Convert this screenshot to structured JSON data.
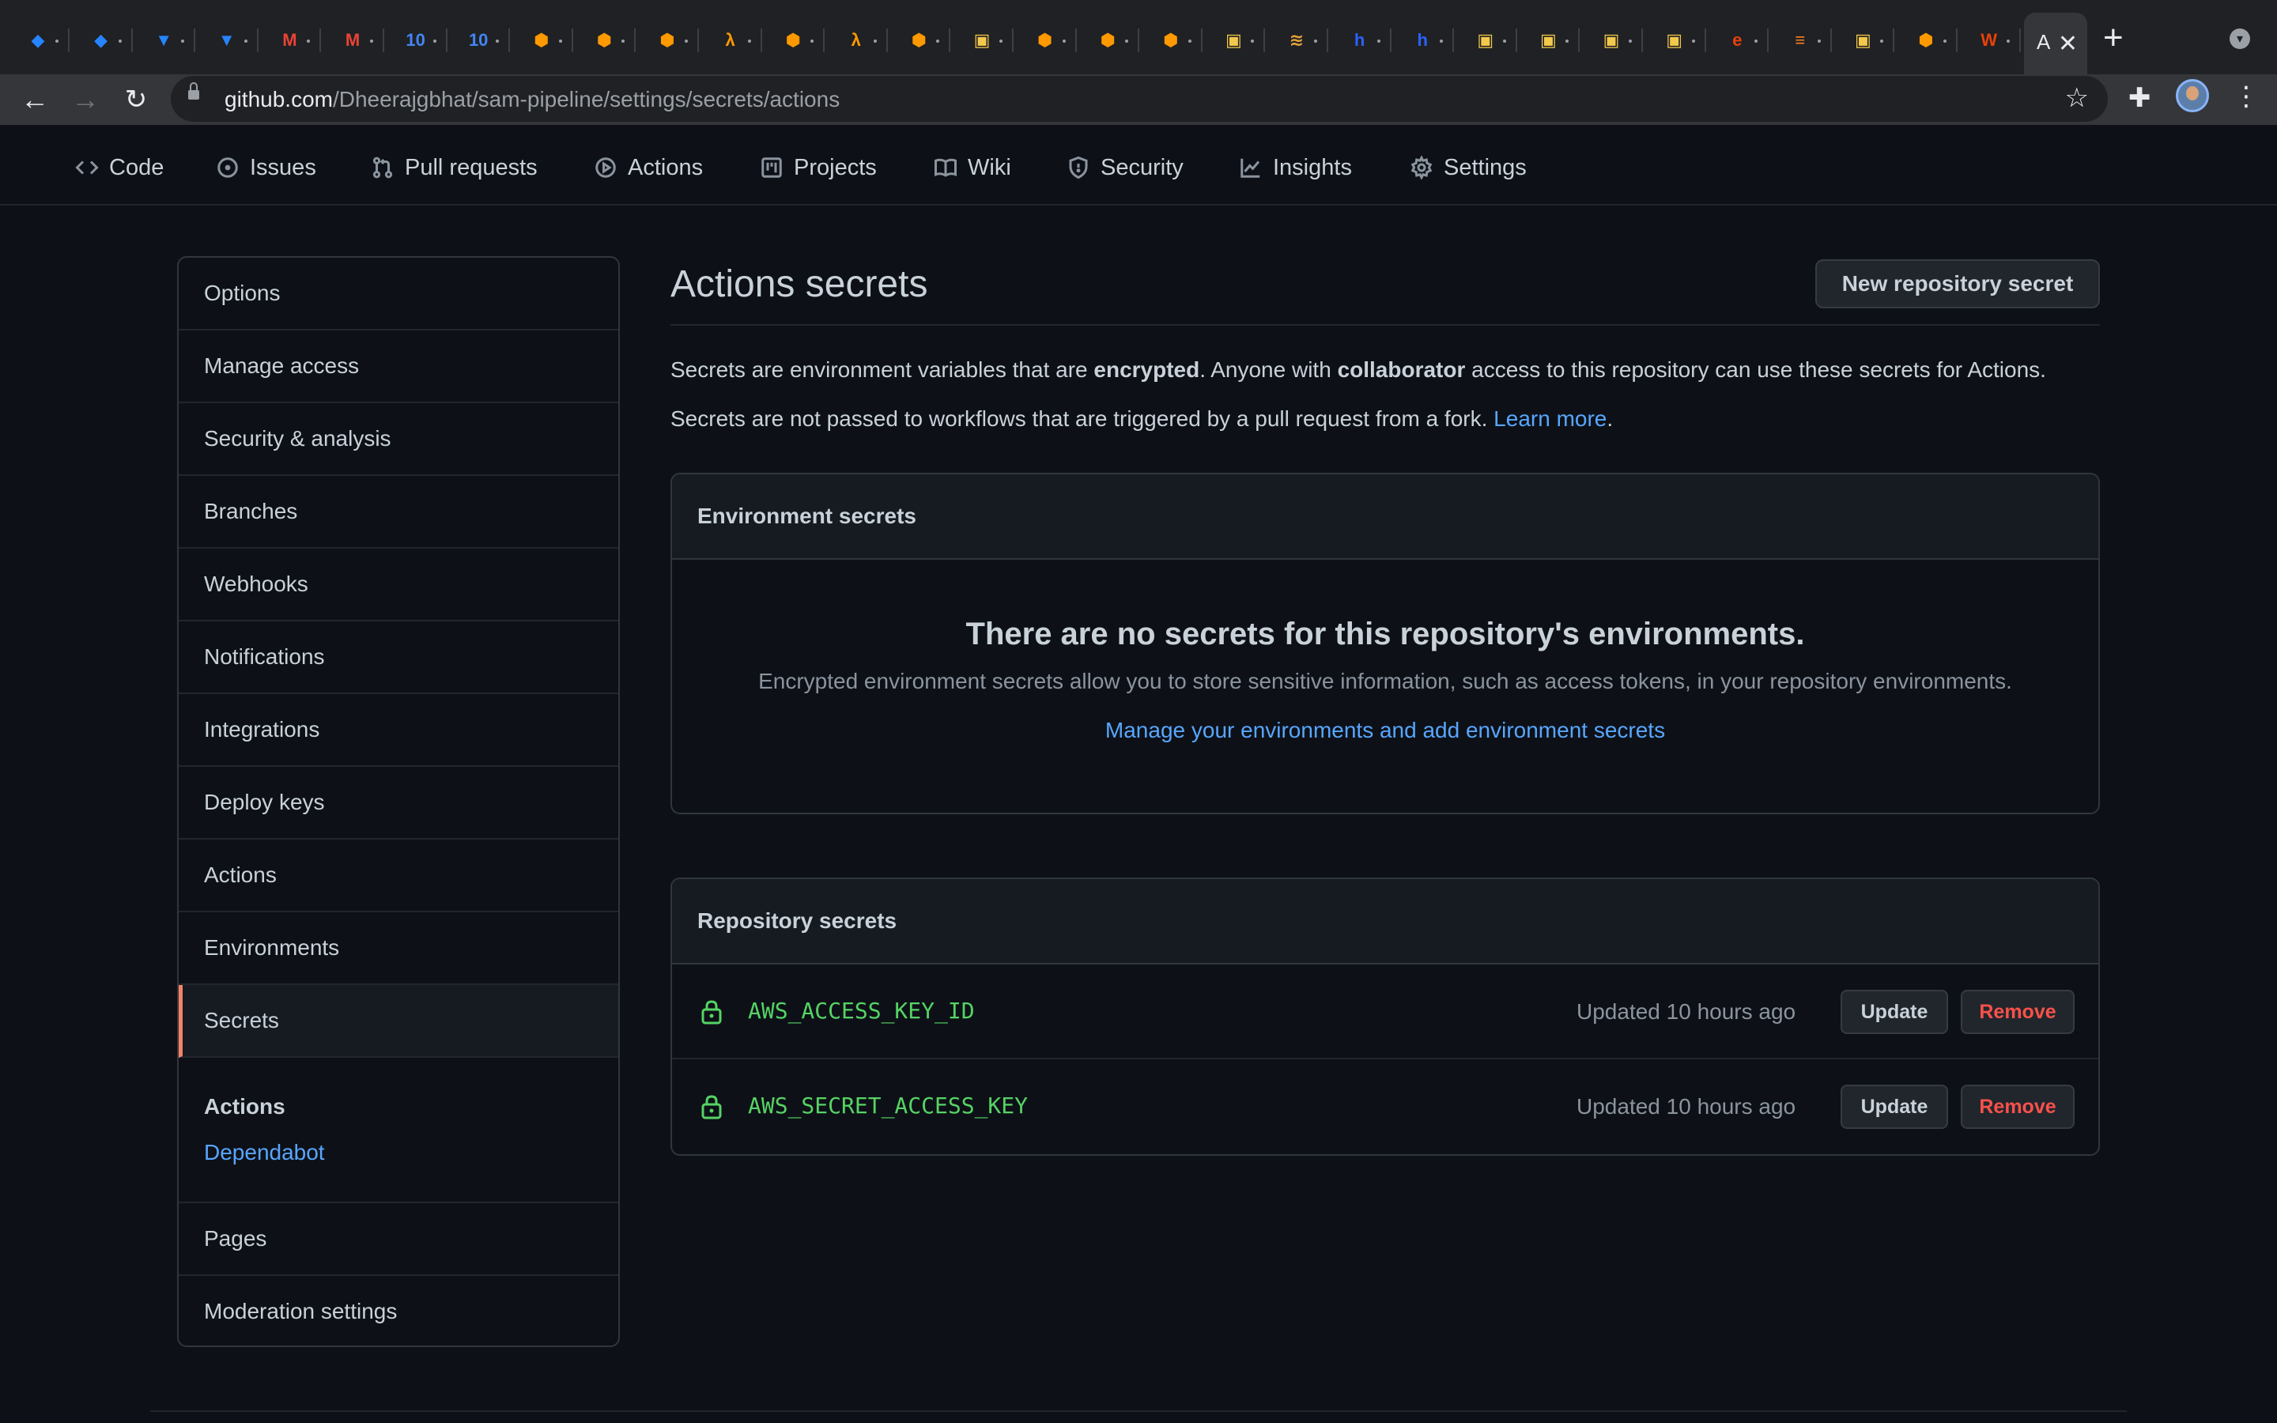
{
  "browser": {
    "tabs": [
      {
        "icon": "jira-icon",
        "color": "#2684ff",
        "glyph": "◆"
      },
      {
        "icon": "jira-icon",
        "color": "#2684ff",
        "glyph": "◆"
      },
      {
        "icon": "bitbucket-icon",
        "color": "#2684ff",
        "glyph": "▼"
      },
      {
        "icon": "bitbucket-icon",
        "color": "#2684ff",
        "glyph": "▼"
      },
      {
        "icon": "gmail-icon",
        "color": "#ea4335",
        "glyph": "M"
      },
      {
        "icon": "gmail-icon",
        "color": "#ea4335",
        "glyph": "M"
      },
      {
        "icon": "calendar-icon",
        "color": "#4285f4",
        "glyph": "10"
      },
      {
        "icon": "calendar-icon",
        "color": "#4285f4",
        "glyph": "10"
      },
      {
        "icon": "aws-service-icon",
        "color": "#ff9900",
        "glyph": "⬢"
      },
      {
        "icon": "aws-service-icon",
        "color": "#ff9900",
        "glyph": "⬢"
      },
      {
        "icon": "aws-service-icon",
        "color": "#ff9900",
        "glyph": "⬢"
      },
      {
        "icon": "aws-lambda-icon",
        "color": "#ff9900",
        "glyph": "λ"
      },
      {
        "icon": "aws-service-icon",
        "color": "#ff9900",
        "glyph": "⬢"
      },
      {
        "icon": "aws-lambda-icon",
        "color": "#ff9900",
        "glyph": "λ"
      },
      {
        "icon": "aws-service-icon",
        "color": "#ff9900",
        "glyph": "⬢"
      },
      {
        "icon": "package-icon",
        "color": "#f2c94c",
        "glyph": "▣"
      },
      {
        "icon": "aws-service-icon",
        "color": "#ff9900",
        "glyph": "⬢"
      },
      {
        "icon": "aws-service-icon",
        "color": "#ff9900",
        "glyph": "⬢"
      },
      {
        "icon": "aws-service-icon",
        "color": "#ff9900",
        "glyph": "⬢"
      },
      {
        "icon": "package-icon",
        "color": "#f2c94c",
        "glyph": "▣"
      },
      {
        "icon": "wave-icon",
        "color": "#e6a23c",
        "glyph": "≋"
      },
      {
        "icon": "hashnode-icon",
        "color": "#2962ff",
        "glyph": "h"
      },
      {
        "icon": "hashnode-icon",
        "color": "#2962ff",
        "glyph": "h"
      },
      {
        "icon": "package-icon",
        "color": "#f2c94c",
        "glyph": "▣"
      },
      {
        "icon": "package-icon",
        "color": "#f2c94c",
        "glyph": "▣"
      },
      {
        "icon": "package-icon",
        "color": "#f2c94c",
        "glyph": "▣"
      },
      {
        "icon": "package-icon",
        "color": "#f2c94c",
        "glyph": "▣"
      },
      {
        "icon": "e-icon",
        "color": "#e8410b",
        "glyph": "e"
      },
      {
        "icon": "stackoverflow-icon",
        "color": "#f48024",
        "glyph": "≡"
      },
      {
        "icon": "package-icon",
        "color": "#f2c94c",
        "glyph": "▣"
      },
      {
        "icon": "aws-service-icon",
        "color": "#ff9900",
        "glyph": "⬢"
      },
      {
        "icon": "w-icon",
        "color": "#e8410b",
        "glyph": "W"
      }
    ],
    "active_tab": {
      "title": "A",
      "close": "✕"
    },
    "new_tab": "+",
    "url_host": "github.com",
    "url_path": "/Dheerajgbhat/sam-pipeline/settings/secrets/actions"
  },
  "repo_nav": {
    "tabs": [
      "Code",
      "Issues",
      "Pull requests",
      "Actions",
      "Projects",
      "Wiki",
      "Security",
      "Insights",
      "Settings"
    ]
  },
  "sidebar": {
    "items": [
      "Options",
      "Manage access",
      "Security & analysis",
      "Branches",
      "Webhooks",
      "Notifications",
      "Integrations",
      "Deploy keys",
      "Actions",
      "Environments",
      "Secrets"
    ],
    "selected": "Secrets",
    "group_heading": "Actions",
    "group_link": "Dependabot",
    "bottom_items": [
      "Pages",
      "Moderation settings"
    ]
  },
  "main": {
    "title": "Actions secrets",
    "new_button": "New repository secret",
    "desc1_a": "Secrets are environment variables that are ",
    "desc1_b": "encrypted",
    "desc1_c": ". Anyone with ",
    "desc1_d": "collaborator",
    "desc1_e": " access to this repository can use these secrets for Actions.",
    "desc2_a": "Secrets are not passed to workflows that are triggered by a pull request from a fork. ",
    "desc2_link": "Learn more",
    "desc2_end": ".",
    "env": {
      "header": "Environment secrets",
      "blank_title": "There are no secrets for this repository's environments.",
      "blank_text": "Encrypted environment secrets allow you to store sensitive information, such as access tokens, in your repository environments.",
      "link": "Manage your environments and add environment secrets"
    },
    "repo_secrets": {
      "header": "Repository secrets",
      "rows": [
        {
          "name": "AWS_ACCESS_KEY_ID",
          "updated": "Updated 10 hours ago",
          "update": "Update",
          "remove": "Remove"
        },
        {
          "name": "AWS_SECRET_ACCESS_KEY",
          "updated": "Updated 10 hours ago",
          "update": "Update",
          "remove": "Remove"
        }
      ]
    }
  }
}
